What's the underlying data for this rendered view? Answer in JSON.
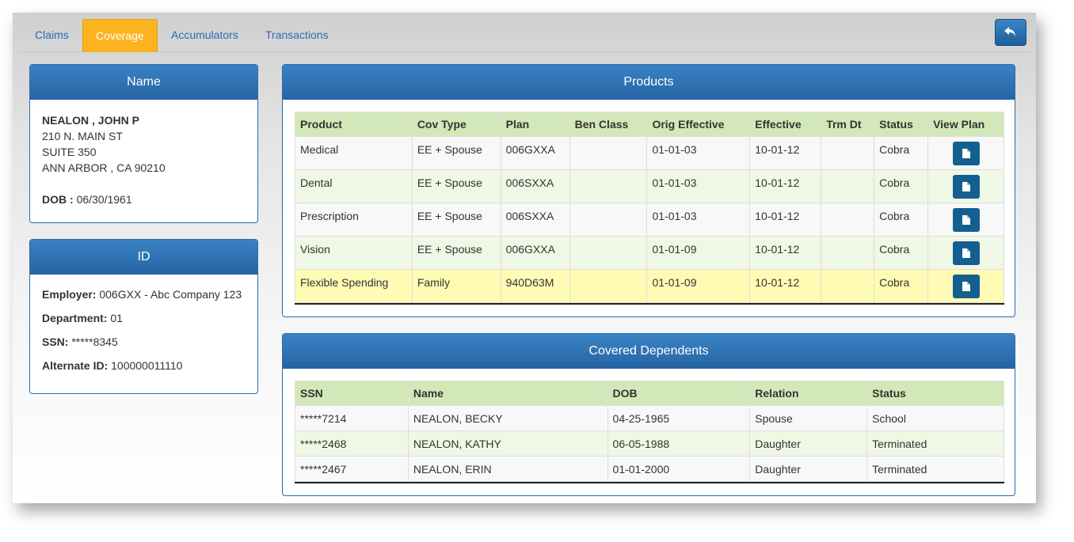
{
  "tabs": [
    {
      "label": "Claims"
    },
    {
      "label": "Coverage"
    },
    {
      "label": "Accumulators"
    },
    {
      "label": "Transactions"
    }
  ],
  "name_panel": {
    "title": "Name",
    "name": "NEALON , JOHN P",
    "address1": "210 N. MAIN ST",
    "address2": "SUITE 350",
    "city_state_zip": "ANN ARBOR , CA 90210",
    "dob_label": "DOB :",
    "dob": "06/30/1961"
  },
  "id_panel": {
    "title": "ID",
    "fields": [
      {
        "label": "Employer:",
        "value": "006GXX - Abc Company 123"
      },
      {
        "label": "Department:",
        "value": "01"
      },
      {
        "label": "SSN:",
        "value": "*****8345"
      },
      {
        "label": "Alternate ID:",
        "value": "100000011110"
      }
    ]
  },
  "products": {
    "title": "Products",
    "columns": [
      "Product",
      "Cov Type",
      "Plan",
      "Ben Class",
      "Orig Effective",
      "Effective",
      "Trm Dt",
      "Status",
      "View Plan"
    ],
    "rows": [
      {
        "product": "Medical",
        "cov_type": "EE + Spouse",
        "plan": "006GXXA",
        "ben_class": "",
        "orig_effective": "01-01-03",
        "effective": "10-01-12",
        "trm_dt": "",
        "status": "Cobra"
      },
      {
        "product": "Dental",
        "cov_type": "EE + Spouse",
        "plan": "006SXXA",
        "ben_class": "",
        "orig_effective": "01-01-03",
        "effective": "10-01-12",
        "trm_dt": "",
        "status": "Cobra"
      },
      {
        "product": "Prescription",
        "cov_type": "EE + Spouse",
        "plan": "006SXXA",
        "ben_class": "",
        "orig_effective": "01-01-03",
        "effective": "10-01-12",
        "trm_dt": "",
        "status": "Cobra"
      },
      {
        "product": "Vision",
        "cov_type": "EE + Spouse",
        "plan": "006GXXA",
        "ben_class": "",
        "orig_effective": "01-01-09",
        "effective": "10-01-12",
        "trm_dt": "",
        "status": "Cobra"
      },
      {
        "product": "Flexible Spending",
        "cov_type": "Family",
        "plan": "940D63M",
        "ben_class": "",
        "orig_effective": "01-01-09",
        "effective": "10-01-12",
        "trm_dt": "",
        "status": "Cobra"
      }
    ]
  },
  "dependents": {
    "title": "Covered Dependents",
    "columns": [
      "SSN",
      "Name",
      "DOB",
      "Relation",
      "Status"
    ],
    "rows": [
      {
        "ssn": "*****7214",
        "name": "NEALON, BECKY",
        "dob": "04-25-1965",
        "relation": "Spouse",
        "status": "School"
      },
      {
        "ssn": "*****2468",
        "name": "NEALON, KATHY",
        "dob": "06-05-1988",
        "relation": "Daughter",
        "status": "Terminated"
      },
      {
        "ssn": "*****2467",
        "name": "NEALON, ERIN",
        "dob": "01-01-2000",
        "relation": "Daughter",
        "status": "Terminated"
      }
    ]
  },
  "icons": {
    "back": "undo-arrow-icon",
    "view_plan": "document-icon"
  },
  "colors": {
    "active_tab": "#fbb41f",
    "panel_header": "#2b6ca9",
    "table_header": "#d3e8b8",
    "highlight_row": "#fffbb5"
  }
}
